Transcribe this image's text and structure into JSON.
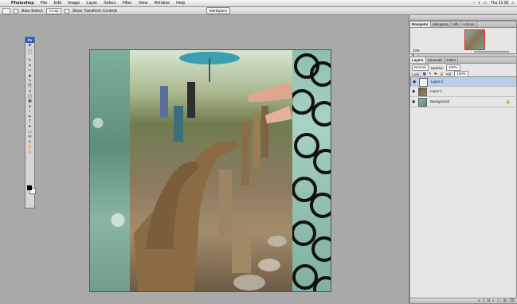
{
  "menubar": {
    "apple": "",
    "app": "Photoshop",
    "items": [
      "File",
      "Edit",
      "Image",
      "Layer",
      "Select",
      "Filter",
      "View",
      "Window",
      "Help"
    ],
    "clock": "Thu 21:28"
  },
  "options": {
    "auto_select_label": "Auto-Select:",
    "auto_select_value": "Group",
    "transform_label": "Show Transform Controls",
    "workspace_label": "Workspace"
  },
  "tools": {
    "ps_label": "Ps",
    "icons": [
      "move",
      "marquee",
      "lasso",
      "quick-select",
      "crop",
      "slice",
      "healing",
      "brush",
      "clone-stamp",
      "history-brush",
      "eraser",
      "gradient",
      "blur",
      "dodge",
      "pen",
      "type",
      "path-select",
      "shape",
      "notes",
      "eyedropper",
      "hand",
      "zoom"
    ],
    "glyphs": [
      "✥",
      "▭",
      "⌒",
      "✎",
      "⌗",
      "✂",
      "✚",
      "✎",
      "⎘",
      "↺",
      "◫",
      "▦",
      "●",
      "◐",
      "✒",
      "T",
      "➤",
      "▭",
      "✉",
      "✎",
      "✋",
      "⌕"
    ],
    "foreground_color": "#000000",
    "background_color": "#ffffff"
  },
  "navigator": {
    "tabs": [
      "Navigator",
      "Histogram",
      "Info",
      "Actions"
    ],
    "zoom": "33%"
  },
  "layers": {
    "tabs": [
      "Layers",
      "Channels",
      "Paths"
    ],
    "blend_mode": "Normal",
    "opacity_label": "Opacity:",
    "opacity_value": "100%",
    "lock_label": "Lock:",
    "fill_label": "Fill:",
    "fill_value": "100%",
    "items": [
      {
        "name": "Layer 2",
        "selected": true
      },
      {
        "name": "Layer 1",
        "selected": false
      },
      {
        "name": "Background",
        "selected": false
      }
    ],
    "bottom_icons": [
      "link-icon",
      "fx-icon",
      "mask-icon",
      "adjustment-icon",
      "folder-icon",
      "new-layer-icon",
      "trash-icon"
    ]
  }
}
